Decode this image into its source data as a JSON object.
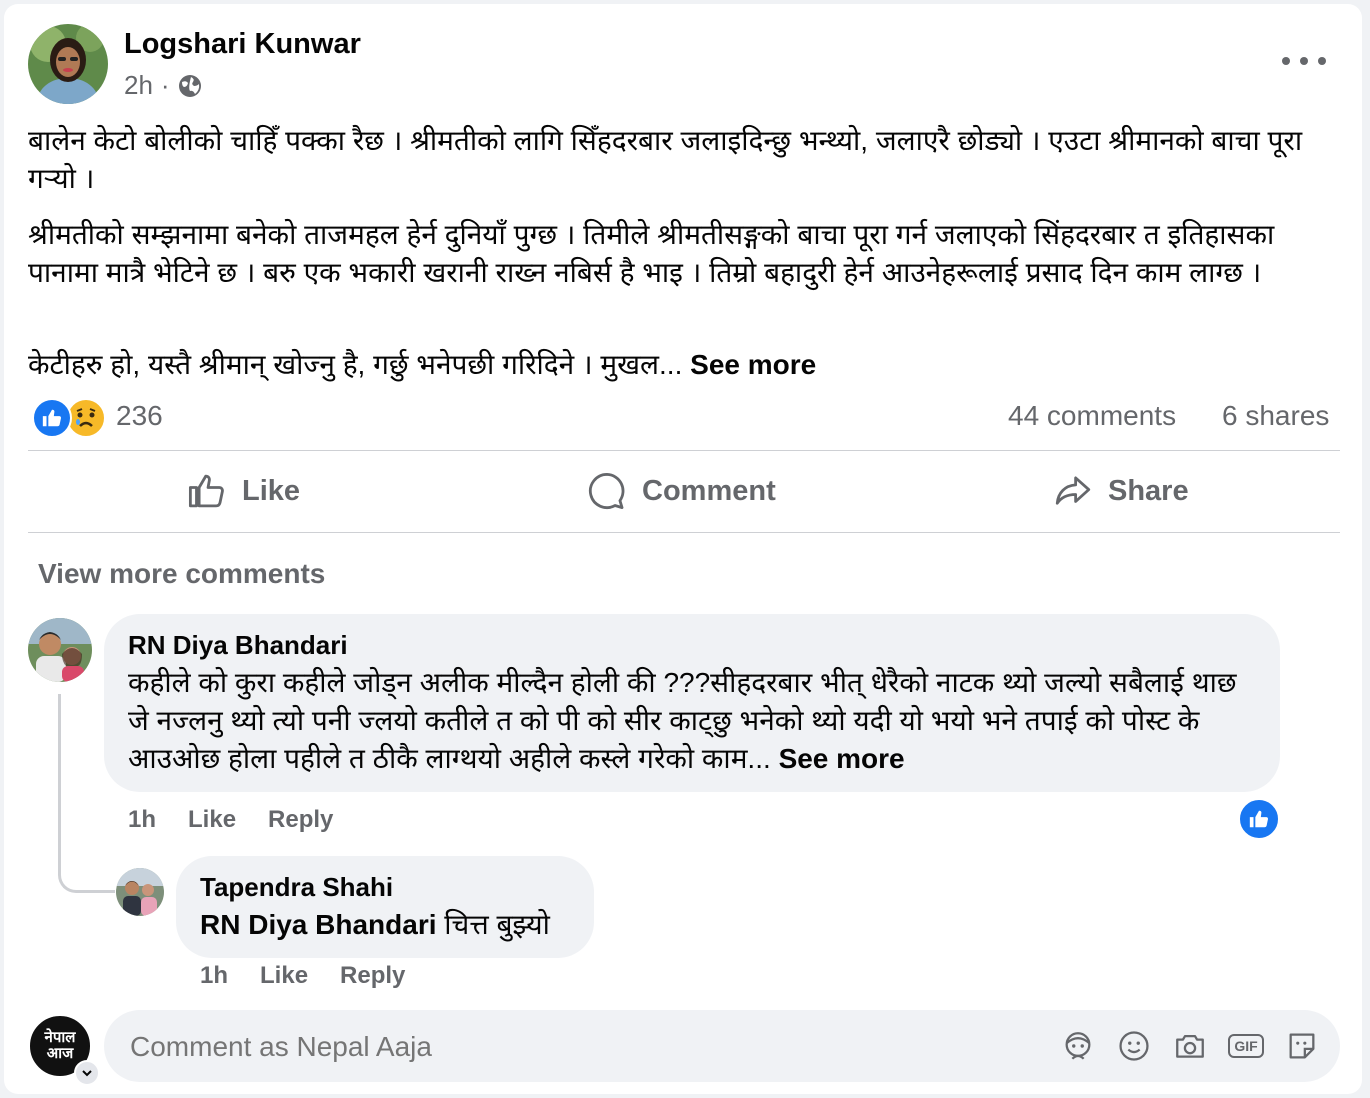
{
  "post": {
    "author": "Logshari Kunwar",
    "time": "2h",
    "audience_icon": "globe-icon",
    "paragraphs": [
      "बालेन केटो बोलीको चाहिँ पक्का रैछ । श्रीमतीको लागि सिँहदरबार जलाइदिन्छु भन्थ्यो, जलाएरै छोड्यो । एउटा श्रीमानको बाचा पूरा गर्‍यो ।",
      "श्रीमतीको सम्झनामा बनेको ताजमहल हेर्न दुनियाँ पुग्छ । तिमीले श्रीमतीसङ्गको बाचा पूरा गर्न जलाएको सिंहदरबार त इतिहासका पानामा मात्रै भेटिने छ । बरु एक भकारी खरानी राख्न नबिर्स है भाइ । तिम्रो बहादुरी हेर्न आउनेहरूलाई प्रसाद दिन काम लाग्छ ।"
    ],
    "last_paragraph": "केटीहरु हो, यस्तै श्रीमान् खोज्नु है, गर्छु भनेपछी गरिदिने । मुखल...",
    "see_more": "See more",
    "reactions_count": "236",
    "comments_count": "44 comments",
    "shares_count": "6 shares"
  },
  "actions": {
    "like": "Like",
    "comment": "Comment",
    "share": "Share"
  },
  "view_more_comments": "View more comments",
  "comments": [
    {
      "author": "RN Diya Bhandari",
      "text": "कहीले को कुरा कहीले जोड्न अलीक मील्दैन होली की ???सीहदरबार भीत् धेरैको नाटक थ्यो जल्यो सबैलाई थाछ जे नज्लनु थ्यो त्यो पनी ज्लयो कतीले त को पी को सीर काट्छु भनेको थ्यो यदी यो भयो भने तपाई को पोस्ट के आउओछ होला पहीले त ठीकै लाग्थयो अहीले कस्ले गरेको काम...",
      "see_more": "See more",
      "time": "1h",
      "like": "Like",
      "reply": "Reply"
    },
    {
      "author": "Tapendra Shahi",
      "mention": "RN Diya Bhandari",
      "text": "चित्त बुझ्यो",
      "time": "1h",
      "like": "Like",
      "reply": "Reply"
    }
  ],
  "composer": {
    "placeholder": "Comment as Nepal Aaja",
    "avatar_text": "नेपाल आज",
    "icons": [
      "avatar-sticker-icon",
      "emoji-icon",
      "camera-icon",
      "gif-icon",
      "sticker-icon"
    ],
    "gif_label": "GIF"
  },
  "colors": {
    "like_blue": "#1877f2",
    "sad_yellow": "#f7b928",
    "text": "#050505",
    "secondary": "#65676b",
    "bubble": "#f0f2f5"
  }
}
